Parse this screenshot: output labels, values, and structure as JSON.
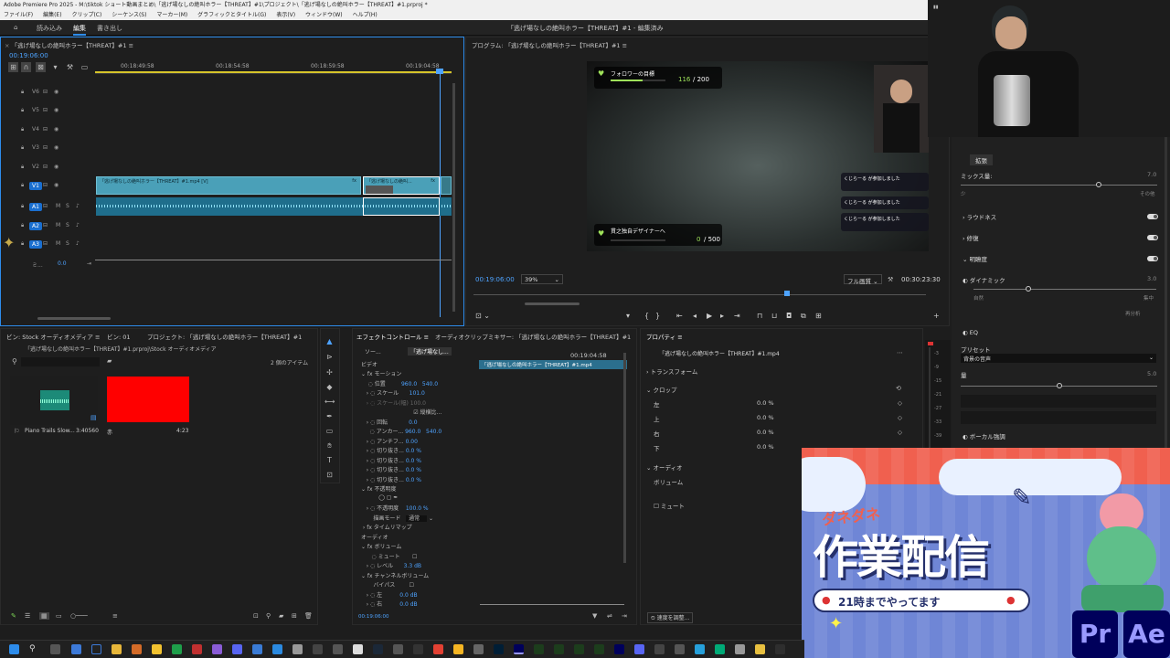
{
  "window": {
    "title": "Adobe Premiere Pro 2025 - M:\\tiktok ショート動画まとめ\\「逃げ場なしの絶叫ホラー【THREAT】#1\\プロジェクト\\「逃げ場なしの絶叫ホラー【THREAT】#1.prproj *"
  },
  "menu": [
    "ファイル(F)",
    "編集(E)",
    "クリップ(C)",
    "シーケンス(S)",
    "マーカー(M)",
    "グラフィックとタイトル(G)",
    "表示(V)",
    "ウィンドウ(W)",
    "ヘルプ(H)"
  ],
  "workspaces": {
    "items": [
      "読み込み",
      "編集",
      "書き出し"
    ],
    "active": "編集",
    "center_title": "「逃げ場なしの絶叫ホラー【THREAT】#1 - 編集済み"
  },
  "timeline": {
    "tab": "「逃げ場なしの絶叫ホラー【THREAT】#1",
    "timecode": "00:19:06:00",
    "ruler": [
      "00:18:49:58",
      "00:18:54:58",
      "00:18:59:58",
      "00:19:04:58"
    ],
    "video_tracks": [
      "V6",
      "V5",
      "V4",
      "V3",
      "V2",
      "V1"
    ],
    "audio_tracks": [
      "A1",
      "A2",
      "A3"
    ],
    "mix_label": "ミ...",
    "mix_value": "0.0",
    "track_mute": "M",
    "track_solo": "S",
    "clip1": "「逃げ場なしの絶叫ホラー【THREAT】#1.mp4 [V]",
    "clip2": "「逃げ場なしの絶叫...",
    "clip_fx": "fx"
  },
  "program": {
    "tab": "プログラム: 「逃げ場なしの絶叫ホラー【THREAT】#1",
    "timecode": "00:19:06:00",
    "zoom": "39%",
    "quality": "フル画質",
    "duration": "00:30:23:30",
    "overlay": {
      "goal1_label": "フォロワーの目標",
      "goal1_current": "116",
      "goal1_total": "/ 200",
      "goal1_fill": 0.58,
      "goal2_label": "貫之独自デザイナーへ",
      "goal2_current": "0",
      "goal2_total": "/ 500",
      "goal2_fill": 0,
      "chat1": "くじらーる",
      "chat2": "くじらーる",
      "chat3": "くじらーる",
      "chat_msg": "が参加しました"
    }
  },
  "project": {
    "tabs": [
      "ビン: Stock オーディオメディア",
      "ビン: 01",
      "プロジェクト: 「逃げ場なしの絶叫ホラー【THREAT】#1"
    ],
    "path": "「逃げ場なしの絶叫ホラー【THREAT】#1.prproj\\Stock オーディオメディア",
    "count": "2 個のアイテム",
    "items": [
      {
        "name": "Piano Trails Slow...",
        "duration": "3:40560",
        "color": "#1c8a78"
      },
      {
        "name": "赤",
        "duration": "4:23",
        "color": "#ff0000"
      }
    ]
  },
  "effects": {
    "tabs": [
      "エフェクトコントロール",
      "オーディオクリップミキサー: 「逃げ場なしの絶叫ホラー【THREAT】#1"
    ],
    "source_tab": "ソー...",
    "seq_tab": "「逃げ場なし...",
    "timecode_top": "00:19:04:58",
    "clip_label": "「逃げ場なしの絶叫ホラー【THREAT】#1.mp4",
    "video_label": "ビデオ",
    "audio_label": "オーディオ",
    "motion": "モーション",
    "position_label": "位置",
    "position_x": "960.0",
    "position_y": "540.0",
    "scale_label": "スケール",
    "scale": "101.0",
    "scale_w_label": "スケール(幅)",
    "scale_w": "100.0",
    "uniform": "縦横比...",
    "rotation_label": "回転",
    "rotation": "0.0",
    "anchor_label": "アンカー...",
    "anchor_x": "960.0",
    "anchor_y": "540.0",
    "antiflicker_label": "アンチフ...",
    "antiflicker": "0.00",
    "crop_label": "切り抜き...",
    "crop": "0.0 %",
    "opacity_label": "不透明度",
    "opacity": "100.0 %",
    "blend_label": "描画モード",
    "blend": "通常",
    "timeremap": "タイムリマップ",
    "volume": "ボリューム",
    "bypass_label": "ミュート",
    "level_label": "レベル",
    "level": "3.3 dB",
    "channel_volume": "チャンネルボリューム",
    "bypass2": "バイパス",
    "left_label": "左",
    "left": "0.0 dB",
    "right_label": "右",
    "right": "0.0 dB",
    "timecode_bottom": "00:19:06:00"
  },
  "properties": {
    "tab": "プロパティ",
    "clip": "「逃げ場なしの絶叫ホラー【THREAT】#1.mp4",
    "transform": "トランスフォーム",
    "crop": "クロップ",
    "rows": [
      {
        "label": "左",
        "value": "0.0 %"
      },
      {
        "label": "上",
        "value": "0.0 %"
      },
      {
        "label": "右",
        "value": "0.0 %"
      },
      {
        "label": "下",
        "value": "0.0 %"
      }
    ],
    "audio": "オーディオ",
    "volume": "ボリューム",
    "mute": "ミュート",
    "footer": "速度を調整..."
  },
  "right_side": {
    "expand": "拡張",
    "mix_label": "ミックス量:",
    "mix_value": "7.0",
    "mix_fill": 0.7,
    "low": "少",
    "high": "その他",
    "loudness": "ラウドネス",
    "sections": [
      "ラウドネス",
      "修復",
      "明瞭度"
    ],
    "dynamic": "ダイナミック",
    "dynamic_value": "3.0",
    "dynamic_fill": 0.3,
    "natural": "自然",
    "focus": "集中",
    "reanalyze": "再分析",
    "eq": "EQ",
    "preset_label": "プリセット",
    "preset": "背景の音声",
    "amount_label": "量",
    "amount_value": "5.0",
    "amount_fill": 0.5,
    "vocal": "ボーカル強調"
  },
  "overlay_banner": {
    "subtitle": "ダネダネ",
    "title": "作業配信",
    "time": "21時までやってます",
    "app1": "Pr",
    "app2": "Ae"
  },
  "colors": {
    "accent": "#2d8ceb",
    "clip": "#4aa0b8",
    "banner_top": "#f0604f",
    "banner_bg": "#6f86d6",
    "pr": "#9999ff",
    "ae": "#9999ff"
  }
}
